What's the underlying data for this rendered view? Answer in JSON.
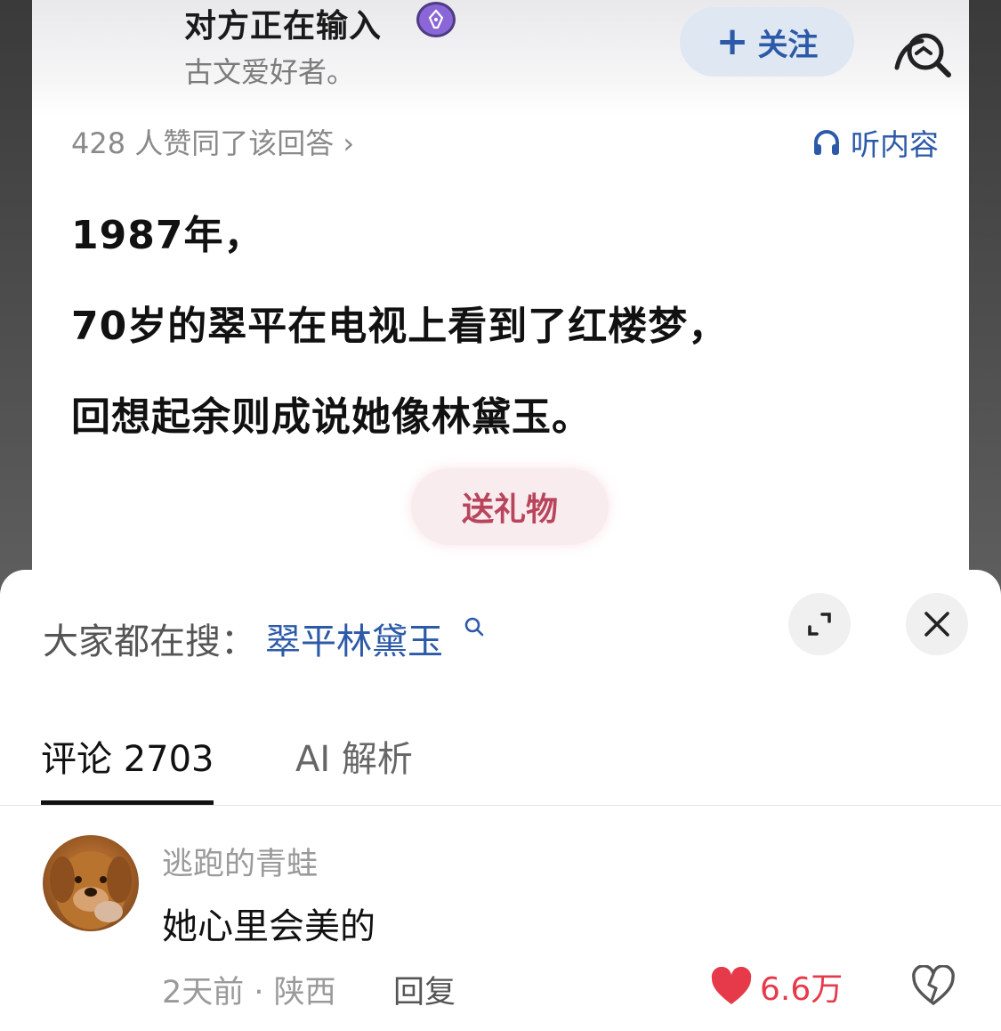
{
  "author": {
    "name": "对方正在输入",
    "bio": "古文爱好者。",
    "follow_label": "关注"
  },
  "answer": {
    "likes_text": "428 人赞同了该回答 ›",
    "listen_label": "听内容",
    "lines": [
      "1987年，",
      "70岁的翠平在电视上看到了红楼梦，",
      "回想起余则成说她像林黛玉。"
    ],
    "gift_label": "送礼物"
  },
  "hot_search": {
    "label": "大家都在搜：",
    "term": "翠平林黛玉"
  },
  "tabs": [
    {
      "label": "评论 2703",
      "active": true
    },
    {
      "label": "AI 解析",
      "active": false
    }
  ],
  "comment": {
    "username": "逃跑的青蛙",
    "text": "她心里会美的",
    "meta": "2天前 · 陕西",
    "reply_label": "回复",
    "like_count": "6.6万"
  },
  "colors": {
    "accent_blue": "#2c5aa8",
    "gift_red": "#b8455c",
    "like_red": "#e63a4a"
  }
}
